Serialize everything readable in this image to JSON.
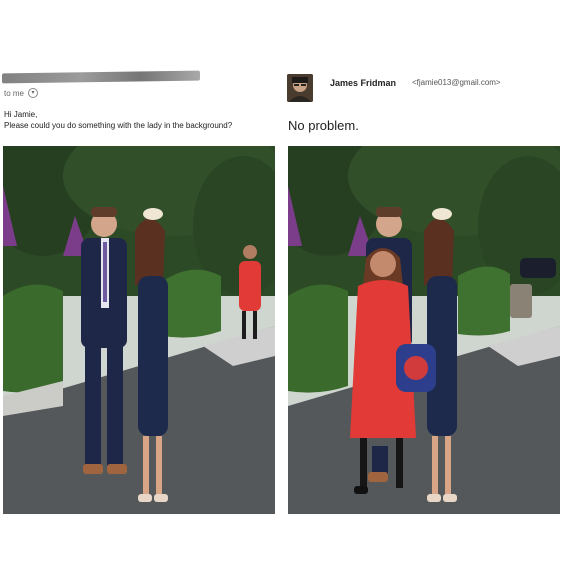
{
  "left_email": {
    "to_label": "to me",
    "greeting": "Hi Jamie,",
    "request": "Please could you do something with the lady in the background?"
  },
  "right_email": {
    "sender_name": "James Fridman",
    "sender_email": "<fjamie013@gmail.com>",
    "reply": "No problem."
  },
  "icons": {
    "expand": "chevron-down-icon",
    "avatar": "sender-avatar"
  },
  "colors": {
    "dress_red": "#e23a36",
    "navy": "#1f2748",
    "foliage": "#2f4a26"
  }
}
